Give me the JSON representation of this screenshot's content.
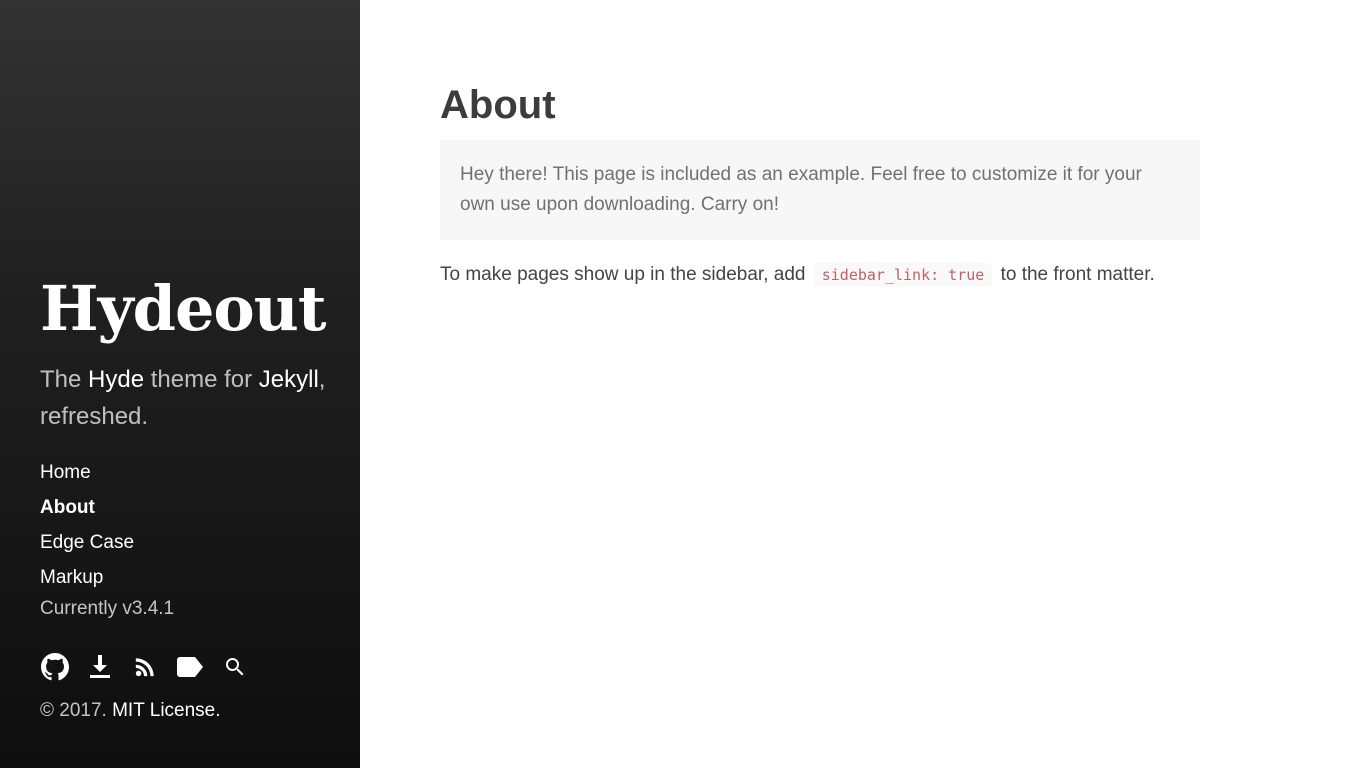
{
  "sidebar": {
    "site_title": "Hydeout",
    "lead": {
      "part1": "The ",
      "hyde": "Hyde",
      "part2": " theme for ",
      "jekyll": "Jekyll",
      "part3": ", refreshed."
    },
    "nav": [
      {
        "label": "Home",
        "active": false
      },
      {
        "label": "About",
        "active": true
      },
      {
        "label": "Edge Case",
        "active": false
      },
      {
        "label": "Markup",
        "active": false
      }
    ],
    "version": "Currently v3.4.1",
    "icons": [
      "github-icon",
      "download-icon",
      "rss-icon",
      "tag-icon",
      "search-icon"
    ],
    "copyright_prefix": "© 2017. ",
    "license_link": "MIT License."
  },
  "main": {
    "title": "About",
    "message": "Hey there! This page is included as an example. Feel free to customize it for your own use upon downloading. Carry on!",
    "body_before": "To make pages show up in the sidebar, add ",
    "body_code": "sidebar_link: true",
    "body_after": " to the front matter."
  },
  "colors": {
    "sidebar_bg_top": "#333333",
    "sidebar_bg_bottom": "#0e0e0e",
    "code_text": "#bf616a",
    "message_bg": "#f7f7f7"
  }
}
